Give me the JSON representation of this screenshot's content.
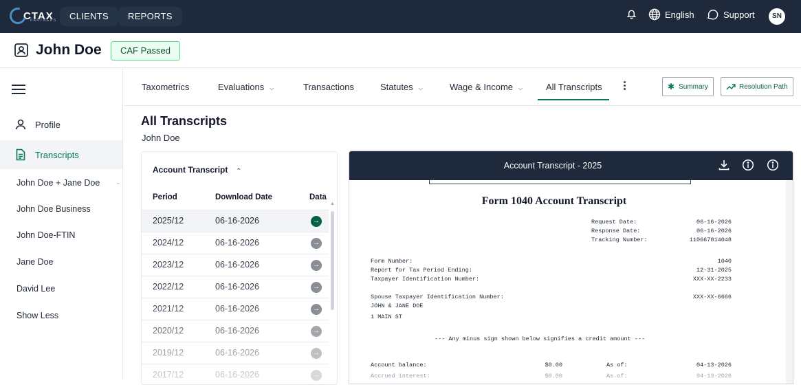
{
  "topnav": {
    "logo_text": "CTAX",
    "logo_sub": "PARTNERS",
    "clients_label": "CLIENTS",
    "reports_label": "REPORTS",
    "language_label": "English",
    "support_label": "Support",
    "avatar_initials": "SN"
  },
  "client": {
    "name": "John Doe",
    "status_badge": "CAF Passed"
  },
  "sidebar": {
    "items": [
      {
        "label": "Profile"
      },
      {
        "label": "Transcripts"
      }
    ],
    "sub_items": [
      {
        "label": "John Doe + Jane Doe"
      },
      {
        "label": "John Doe Business"
      },
      {
        "label": "John Doe-FTIN"
      },
      {
        "label": "Jane Doe"
      },
      {
        "label": "David Lee"
      },
      {
        "label": "Show Less"
      }
    ]
  },
  "tabs": {
    "taxometrics": "Taxometrics",
    "evaluations": "Evaluations",
    "transactions": "Transactions",
    "statutes": "Statutes",
    "wage_income": "Wage & Income",
    "all_transcripts": "All Transcripts",
    "summary_button": "Summary",
    "resolution_button": "Resolution Path"
  },
  "page": {
    "title": "All Transcripts",
    "subtitle": "John Doe"
  },
  "transcript_list": {
    "header": "Account Transcript",
    "columns": {
      "period": "Period",
      "download_date": "Download Date",
      "data": "Data"
    },
    "rows": [
      {
        "period": "2025/12",
        "date": "06-16-2026"
      },
      {
        "period": "2024/12",
        "date": "06-16-2026"
      },
      {
        "period": "2023/12",
        "date": "06-16-2026"
      },
      {
        "period": "2022/12",
        "date": "06-16-2026"
      },
      {
        "period": "2021/12",
        "date": "06-16-2026"
      },
      {
        "period": "2020/12",
        "date": "06-16-2026"
      },
      {
        "period": "2019/12",
        "date": "06-16-2026"
      },
      {
        "period": "2017/12",
        "date": "06-16-2026"
      }
    ]
  },
  "viewer": {
    "title": "Account Transcript - 2025",
    "doc_title": "Form 1040 Account Transcript",
    "request_date_label": "Request Date:",
    "request_date": "06-16-2026",
    "response_date_label": "Response Date:",
    "response_date": "06-16-2026",
    "tracking_label": "Tracking Number:",
    "tracking_number": "110667814048",
    "form_number_label": "Form Number:",
    "form_number": "1040",
    "period_ending_label": "Report for Tax Period Ending:",
    "period_ending": "12-31-2025",
    "tin_label": "Taxpayer Identification Number:",
    "tin": "XXX-XX-2233",
    "spouse_tin_label": "Spouse Taxpayer Identification Number:",
    "spouse_tin": "XXX-XX-6666",
    "taxpayer_names": "JOHN & JANE DOE",
    "address": "1 MAIN ST",
    "minus_note": "--- Any minus sign shown below signifies a credit amount ---",
    "account_balance_label": "Account balance:",
    "account_balance": "$0.00",
    "as_of_label": "As of:",
    "account_balance_date": "04-13-2026",
    "accrued_interest_label": "Accrued interest:",
    "accrued_interest": "$0.00",
    "accrued_interest_date": "04-13-2026"
  }
}
